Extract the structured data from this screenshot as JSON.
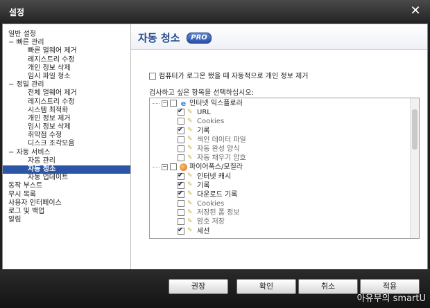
{
  "window": {
    "title": "설정",
    "close_icon": "close-icon"
  },
  "sidebar": {
    "items": [
      {
        "label": "일반 설정",
        "level": 0,
        "prefix": ""
      },
      {
        "label": "빠른 관리",
        "level": 0,
        "prefix": "− "
      },
      {
        "label": "빠른 멀웨어 제거",
        "level": 1,
        "prefix": ""
      },
      {
        "label": "레지스트리 수정",
        "level": 1,
        "prefix": ""
      },
      {
        "label": "개인 정보 삭제",
        "level": 1,
        "prefix": ""
      },
      {
        "label": "임시 파일 청소",
        "level": 1,
        "prefix": ""
      },
      {
        "label": "정밀 관리",
        "level": 0,
        "prefix": "− "
      },
      {
        "label": "전체 멀웨어 제거",
        "level": 1,
        "prefix": ""
      },
      {
        "label": "레지스트리 수정",
        "level": 1,
        "prefix": ""
      },
      {
        "label": "시스템 최적화",
        "level": 1,
        "prefix": ""
      },
      {
        "label": "개인 정보 제거",
        "level": 1,
        "prefix": ""
      },
      {
        "label": "임시 정보 삭제",
        "level": 1,
        "prefix": ""
      },
      {
        "label": "취약점 수정",
        "level": 1,
        "prefix": ""
      },
      {
        "label": "디스크 조각모음",
        "level": 1,
        "prefix": ""
      },
      {
        "label": "자동 서비스",
        "level": 0,
        "prefix": "− "
      },
      {
        "label": "자동 관리",
        "level": 1,
        "prefix": ""
      },
      {
        "label": "자동 청소",
        "level": 1,
        "prefix": "",
        "selected": true
      },
      {
        "label": "자동 업데이트",
        "level": 1,
        "prefix": ""
      },
      {
        "label": "동작 부스트",
        "level": 0,
        "prefix": ""
      },
      {
        "label": "무시 목록",
        "level": 0,
        "prefix": ""
      },
      {
        "label": "사용자 인터페이스",
        "level": 0,
        "prefix": ""
      },
      {
        "label": "로그 및 백업",
        "level": 0,
        "prefix": ""
      },
      {
        "label": "알림",
        "level": 0,
        "prefix": ""
      }
    ]
  },
  "content": {
    "title": "자동 청소",
    "badge": "PRO",
    "option_label": "컴퓨터가 로그온 됐을 때 자동적으로 개인 정보 제거",
    "option_checked": false,
    "prompt": "검사하고 싶은 항목을 선택하십시오:",
    "tree": [
      {
        "type": "group",
        "label": "인터넷 익스플로러",
        "icon": "internet-explorer-icon",
        "checked": false
      },
      {
        "type": "item",
        "label": "URL",
        "checked": true
      },
      {
        "type": "item",
        "label": "Cookies",
        "checked": false
      },
      {
        "type": "item",
        "label": "기록",
        "checked": true
      },
      {
        "type": "item",
        "label": "색인 데이터 파일",
        "checked": false
      },
      {
        "type": "item",
        "label": "자동 완성 양식",
        "checked": false
      },
      {
        "type": "item",
        "label": "자동 채우기 암호",
        "checked": false
      },
      {
        "type": "group",
        "label": "파이어폭스/모질라",
        "icon": "firefox-icon",
        "checked": false
      },
      {
        "type": "item",
        "label": "인터넷 캐시",
        "checked": true
      },
      {
        "type": "item",
        "label": "기록",
        "checked": true
      },
      {
        "type": "item",
        "label": "다운로드 기록",
        "checked": true
      },
      {
        "type": "item",
        "label": "Cookies",
        "checked": false
      },
      {
        "type": "item",
        "label": "저장된 폼 정보",
        "checked": false
      },
      {
        "type": "item",
        "label": "암호 저장",
        "checked": false
      },
      {
        "type": "item",
        "label": "세션",
        "checked": true
      }
    ]
  },
  "buttons": {
    "recommend": "권장",
    "ok": "확인",
    "cancel": "취소",
    "apply": "적용"
  },
  "watermark": "아유무의 smartU"
}
